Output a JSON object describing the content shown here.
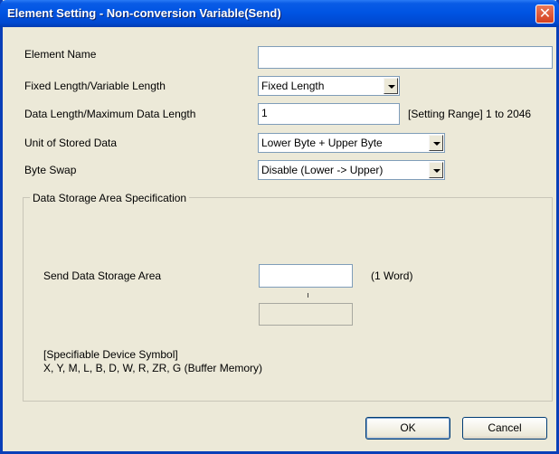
{
  "window": {
    "title": "Element Setting - Non-conversion Variable(Send)",
    "close_glyph": "✕"
  },
  "form": {
    "element_name": {
      "label": "Element Name",
      "value": ""
    },
    "length_type": {
      "label": "Fixed Length/Variable Length",
      "value": "Fixed Length"
    },
    "data_length": {
      "label": "Data Length/Maximum Data Length",
      "value": "1",
      "range_note": "[Setting Range] 1 to 2046"
    },
    "unit": {
      "label": "Unit of Stored Data",
      "value": "Lower Byte + Upper Byte"
    },
    "byte_swap": {
      "label": "Byte Swap",
      "value": "Disable (Lower -> Upper)"
    }
  },
  "storage": {
    "group_label": "Data Storage Area Specification",
    "send_label": "Send Data Storage Area",
    "send_value": "",
    "word_note": "(1 Word)",
    "device_header": "[Specifiable Device Symbol]",
    "device_list": "X, Y, M, L, B, D, W, R, ZR, G (Buffer Memory)"
  },
  "buttons": {
    "ok": "OK",
    "cancel": "Cancel"
  },
  "icons": {
    "close": "close-icon",
    "dropdown": "chevron-down-icon"
  }
}
